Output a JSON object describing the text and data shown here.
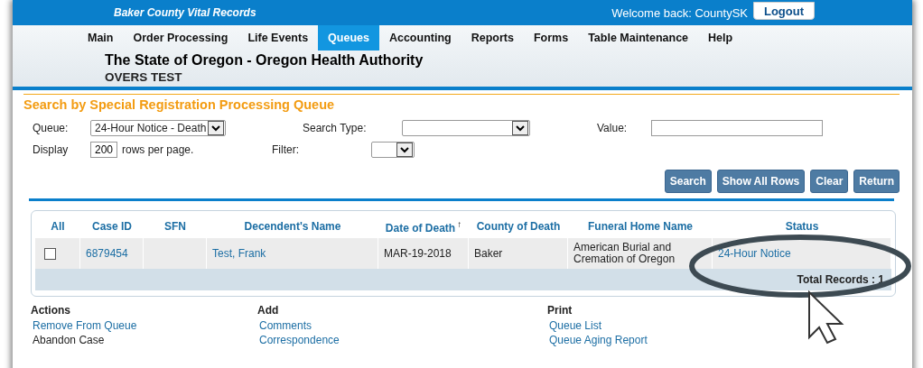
{
  "top_bar": {
    "title": "Baker County Vital Records",
    "welcome": "Welcome back: CountySK",
    "logout": "Logout"
  },
  "menu": [
    {
      "label": "Main",
      "selected": false
    },
    {
      "label": "Order Processing",
      "selected": false
    },
    {
      "label": "Life Events",
      "selected": false
    },
    {
      "label": "Queues",
      "selected": true
    },
    {
      "label": "Accounting",
      "selected": false
    },
    {
      "label": "Reports",
      "selected": false
    },
    {
      "label": "Forms",
      "selected": false
    },
    {
      "label": "Table Maintenance",
      "selected": false
    },
    {
      "label": "Help",
      "selected": false
    }
  ],
  "header": {
    "agency": "The State of Oregon - Oregon Health Authority",
    "environment": "OVERS TEST"
  },
  "search": {
    "title": "Search by Special Registration Processing Queue",
    "queue_label": "Queue:",
    "queue_value": "24-Hour Notice - Death",
    "search_type_label": "Search Type:",
    "value_label": "Value:",
    "display_label": "Display",
    "display_value": "200",
    "rows_per_page": "rows per page.",
    "filter_label": "Filter:"
  },
  "buttons": [
    "Search",
    "Show All Rows",
    "Clear",
    "Return"
  ],
  "table": {
    "columns": [
      {
        "label": "All"
      },
      {
        "label": "Case ID"
      },
      {
        "label": "SFN"
      },
      {
        "label": "Decendent's Name"
      },
      {
        "label": "Date of Death",
        "sort": "↑"
      },
      {
        "label": "County of Death"
      },
      {
        "label": "Funeral Home Name"
      },
      {
        "label": "Status"
      }
    ],
    "rows": [
      {
        "checked": false,
        "case_id": "6879454",
        "sfn": "",
        "name": "Test, Frank",
        "date_of_death": "MAR-19-2018",
        "county": "Baker",
        "funeral_home": "American Burial and Cremation of Oregon",
        "status": "24-Hour Notice"
      }
    ],
    "footer": "Total Records : 1"
  },
  "sections": [
    {
      "title": "Actions",
      "items": [
        {
          "label": "Remove From Queue",
          "disabled": false
        },
        {
          "label": "Abandon Case",
          "disabled": true
        }
      ]
    },
    {
      "title": "Add",
      "items": [
        {
          "label": "Comments",
          "disabled": false
        },
        {
          "label": "Correspondence",
          "disabled": false
        }
      ]
    },
    {
      "title": "Print",
      "items": [
        {
          "label": "Queue List",
          "disabled": false
        },
        {
          "label": "Queue Aging Report",
          "disabled": false
        }
      ]
    }
  ]
}
